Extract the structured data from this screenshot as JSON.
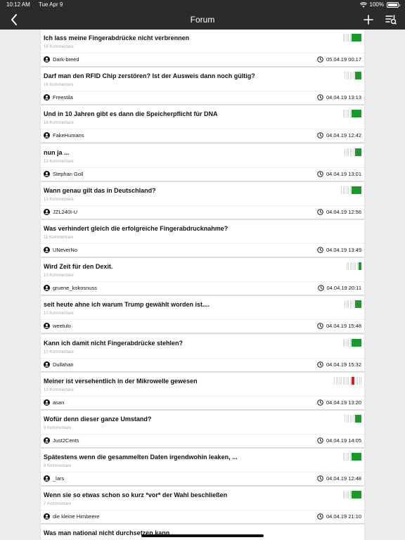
{
  "status": {
    "time": "10:12 AM",
    "date": "Tue Apr 9",
    "battery": "100%",
    "battery_level": 1.0
  },
  "nav": {
    "title": "Forum",
    "back_icon": "chevron-left-icon",
    "add_icon": "plus-icon",
    "filter_icon": "sort-filter-icon"
  },
  "colors": {
    "bar": "#2b2b2b",
    "positive": "#1a9a2a",
    "negative": "#cc2222",
    "neutral_tick": "#d4d4d4"
  },
  "posts": [
    {
      "title": "Ich lass meine Fingerabdrücke nicht verbrennen",
      "comments": "16 Kommentare",
      "author": "Dark-breed",
      "date": "05.04.19 00:17",
      "vote": {
        "ticks": 5,
        "bar": "wide",
        "color": "green"
      }
    },
    {
      "title": "Darf man den RFID Chip zerstören? Ist der Ausweis dann noch gültig?",
      "comments": "16 Kommentare",
      "author": "Freestila",
      "date": "04.04.19 13:13",
      "vote": {
        "ticks": 6,
        "bar": "medium",
        "color": "green"
      }
    },
    {
      "title": "Und in 10 Jahren gibt es dann die Speicherpflicht für DNA",
      "comments": "16 Kommentare",
      "author": "FakeHumans",
      "date": "04.04.19 12:42",
      "vote": {
        "ticks": 5,
        "bar": "wide",
        "color": "green"
      }
    },
    {
      "title": "nun ja ...",
      "comments": "13 Kommentare",
      "author": "Stephan Goll",
      "date": "04.04.19 13:01",
      "vote": {
        "ticks": 6,
        "bar": "medium",
        "color": "green"
      }
    },
    {
      "title": "Wann genau gilt das in Deutschland?",
      "comments": "13 Kommentare",
      "author": "JZL240I-U",
      "date": "04.04.19 12:56",
      "vote": {
        "ticks": 6,
        "bar": "wide",
        "color": "green"
      }
    },
    {
      "title": "Was verhindert gleich die erfolgreiche Fingerabdrucknahme?",
      "comments": "11 Kommentare",
      "author": "UNeverNo",
      "date": "04.04.19 13:49",
      "vote": {
        "ticks": 0,
        "bar": "none",
        "color": "none"
      }
    },
    {
      "title": "Wird Zeit für den Dexit.",
      "comments": "10 Kommentare",
      "author": "gruene_kokosnuss",
      "date": "04.04.19 20:11",
      "vote": {
        "ticks": 7,
        "bar": "narrow",
        "color": "green"
      }
    },
    {
      "title": "seit heute ahne ich warum Trump gewählt worden ist....",
      "comments": "10 Kommentare",
      "author": "weetulo",
      "date": "04.04.19 15:48",
      "vote": {
        "ticks": 6,
        "bar": "medium",
        "color": "green"
      }
    },
    {
      "title": "Kann ich damit nicht Fingerabdrücke stehlen?",
      "comments": "10 Kommentare",
      "author": "Dullahan",
      "date": "04.04.19 15:32",
      "vote": {
        "ticks": 5,
        "bar": "wide",
        "color": "green"
      }
    },
    {
      "title": "Meiner ist versehentlich in der Mikrowelle gewesen",
      "comments": "10 Kommentare",
      "author": "asan",
      "date": "04.04.19 13:20",
      "vote": {
        "ticks": 10,
        "bar": "narrow",
        "color": "red"
      }
    },
    {
      "title": "Wofür denn dieser ganze Umstand?",
      "comments": "9 Kommentare",
      "author": "Just2Cents",
      "date": "04.04.19 14:05",
      "vote": {
        "ticks": 6,
        "bar": "medium",
        "color": "green"
      }
    },
    {
      "title": "Spätestens wenn die gesammelten Daten irgendwohin leaken, ...",
      "comments": "8 Kommentare",
      "author": "_lars",
      "date": "04.04.19 12:48",
      "vote": {
        "ticks": 5,
        "bar": "wide",
        "color": "green"
      }
    },
    {
      "title": "Wenn sie so etwas schon so kurz *vor* der Wahl beschließen",
      "comments": "7 Kommentare",
      "author": "die kleine Himbeere",
      "date": "04.04.19 21:10",
      "vote": {
        "ticks": 5,
        "bar": "wide",
        "color": "green"
      }
    },
    {
      "title": "Was man national nicht durchsetzen kann",
      "comments": "",
      "author": "",
      "date": "",
      "vote": {
        "ticks": 0,
        "bar": "none",
        "color": "none"
      }
    }
  ]
}
